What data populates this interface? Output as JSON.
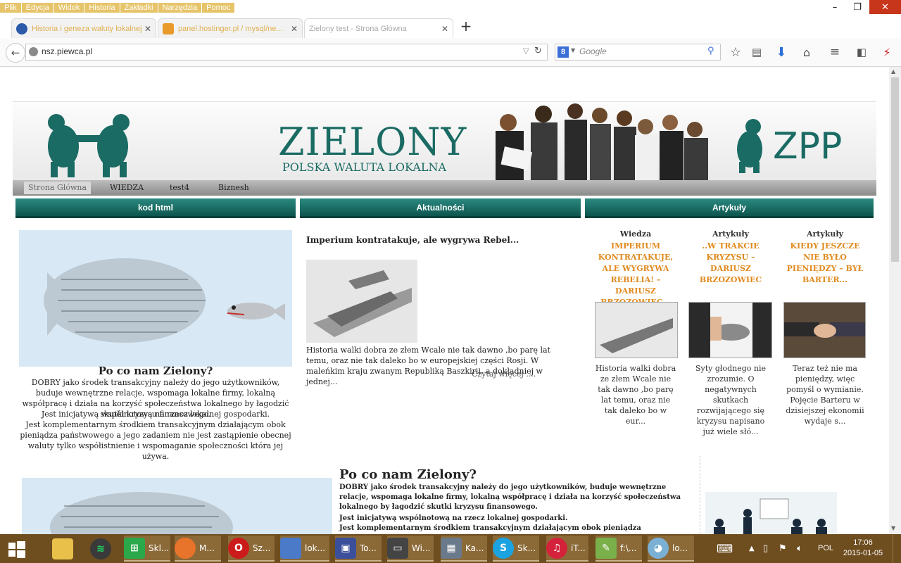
{
  "browser": {
    "menu": [
      "Plik",
      "Edycja",
      "Widok",
      "Historia",
      "Zakładki",
      "Narzędzia",
      "Pomoc"
    ],
    "tabs": [
      {
        "title": "Historia i geneza waluty lokalnej...",
        "favicon_color": "#2a5aa8"
      },
      {
        "title": "panel.hostinger.pl / mysql/ne...",
        "favicon_color": "#e89a2a"
      },
      {
        "title": "Zielony test - Strona Główna",
        "favicon_color": "#ffffff"
      }
    ],
    "url": "nsz.piewca.pl",
    "search_placeholder": "Google",
    "search_engine_letter": "8"
  },
  "site": {
    "logo_title": "ZIELONY",
    "logo_subtitle": "POLSKA WALUTA LOKALNA",
    "logo_right": "ZPP",
    "nav": [
      "Strona Główna",
      "WIEDZA",
      "test4",
      "Biznesh"
    ],
    "sections": [
      "kod html",
      "Aktualności",
      "Artykuły"
    ],
    "intro": {
      "heading": "Po co nam Zielony?",
      "body": "DOBRY jako środek transakcyjny należy do jego użytkowników, buduje wewnętrzne relacje, wspomaga lokalne firmy, lokalną współpracę i działa na korzyść społeczeństwa lokalnego by łagodzić skutki kryzysu finansowego.",
      "body2": "Jest inicjatywą wspólnotową na rzecz lokalnej gospodarki.",
      "body3": "Jest komplementarnym środkiem transakcyjnym działającym obok pieniądza państwowego a jego zadaniem nie jest zastąpienie obecnej waluty tylko współistnienie i wspomaganie społeczności która jej używa."
    },
    "news": {
      "title": "Imperium kontratakuje, ale wygrywa Rebel...",
      "excerpt": "Historia walki dobra ze złem Wcale nie tak dawno ,bo parę lat temu, oraz nie tak daleko bo w europejskiej części Rosji. W maleńkim kraju zwanym Republiką Baszkirii, a dokładniej w jednej...",
      "more": "Czytaj więcej ...."
    },
    "articles": [
      {
        "category": "Wiedza",
        "title": "IMPERIUM KONTRATAKUJE, ALE WYGRYWA REBELIA! – DARIUSZ BRZOZOWIEC...",
        "desc": "Historia walki dobra ze złem Wcale nie tak dawno ,bo parę lat temu, oraz nie tak daleko bo w eur..."
      },
      {
        "category": "Artykuły",
        "title": "..W TRAKCIE KRYZYSU – DARIUSZ BRZOZOWIEC",
        "desc": "Syty głodnego nie zrozumie. O negatywnych skutkach rozwijającego się kryzysu napisano już wiele słó..."
      },
      {
        "category": "Artykuły",
        "title": "KIEDY JESZCZE NIE BYŁO PIENIĘDZY – BYŁ BARTER...",
        "desc": "Teraz też nie ma pieniędzy, więc pomyśl o wymianie. Pojęcie Barteru w dzisiejszej ekonomii wydaje s..."
      }
    ],
    "second": {
      "heading": "Po co nam Zielony?",
      "body": "DOBRY jako środek transakcyjny należy do jego użytkowników, buduje wewnętrzne relacje, wspomaga lokalne firmy, lokalną współpracę i działa na korzyść społeczeństwa lokalnego by łagodzić skutki kryzysu finansowego.",
      "body2": "Jest inicjatywą wspólnotową na rzecz lokalnej gospodarki.",
      "body3": "Jest komplementarnym środkiem transakcyjnym działającym obok pieniądza państwowego a jego zadaniem"
    }
  },
  "taskbar": {
    "items": [
      {
        "label": "",
        "icon": "start-icon",
        "color": "#6e4d1f"
      },
      {
        "label": "",
        "icon": "explorer-icon",
        "color": "#e8c04a"
      },
      {
        "label": "",
        "icon": "spotify-icon",
        "color": "#3a3a3a"
      },
      {
        "label": "Skl...",
        "icon": "store-icon",
        "color": "#2aa84a"
      },
      {
        "label": "M...",
        "icon": "firefox-icon",
        "color": "#e8732a"
      },
      {
        "label": "Sz...",
        "icon": "opera-icon",
        "color": "#cc1b1b"
      },
      {
        "label": "lok...",
        "icon": "virtualbox-icon",
        "color": "#4a7ac8"
      },
      {
        "label": "To...",
        "icon": "save-icon",
        "color": "#3b4f9a"
      },
      {
        "label": "Wi...",
        "icon": "window-icon",
        "color": "#444"
      },
      {
        "label": "Ka...",
        "icon": "calculator-icon",
        "color": "#6a7a8a"
      },
      {
        "label": "Sk...",
        "icon": "skype-icon",
        "color": "#1aa3e0"
      },
      {
        "label": "iT...",
        "icon": "itunes-icon",
        "color": "#d4223a"
      },
      {
        "label": "f:\\...",
        "icon": "notepad-icon",
        "color": "#7ab04a"
      },
      {
        "label": "lo...",
        "icon": "paint-icon",
        "color": "#7ab0d4"
      }
    ],
    "language": "POL",
    "time": "17:06",
    "date": "2015-01-05"
  }
}
